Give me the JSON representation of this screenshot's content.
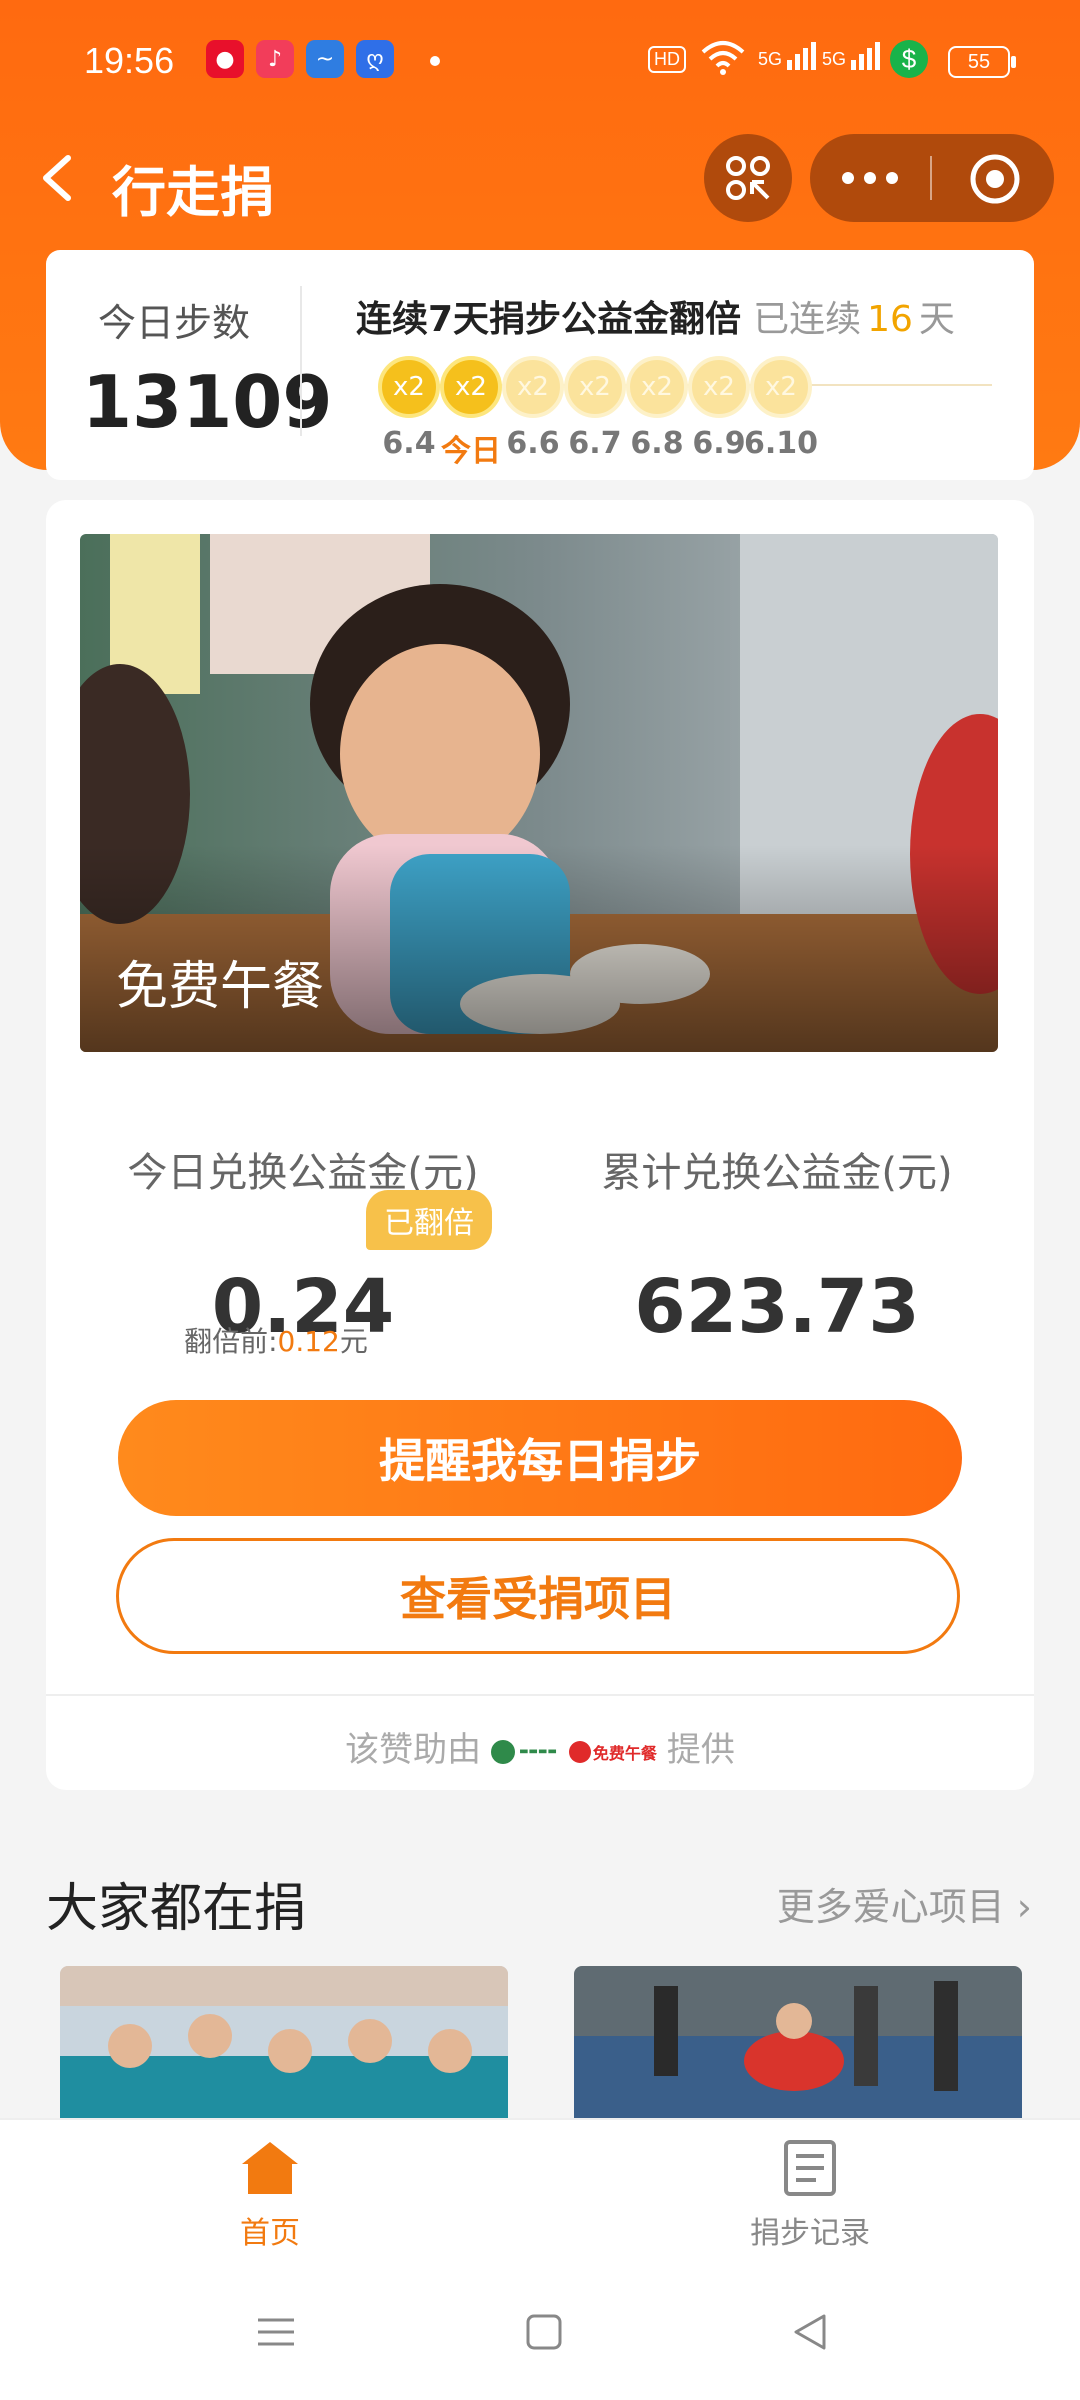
{
  "status_bar": {
    "time": "19:56",
    "apps": [
      {
        "icon": "taobao-icon",
        "color": "#e8102b"
      },
      {
        "icon": "music-icon",
        "color": "#f23d5a"
      },
      {
        "icon": "bird-icon",
        "color": "#2f7de1"
      },
      {
        "icon": "baidu-icon",
        "color": "#2f6fe8"
      }
    ],
    "network_hd": "HD",
    "signal_1": "5G",
    "signal_2": "5G",
    "battery": "55"
  },
  "nav": {
    "title": "行走捐"
  },
  "steps": {
    "label": "今日步数",
    "value": "13109",
    "streak_title": "连续7天捐步公益金翻倍",
    "streak_prefix": "已连续",
    "streak_days": "16",
    "streak_suffix": "天",
    "days": [
      {
        "label": "x2",
        "date": "6.4",
        "state": "done"
      },
      {
        "label": "x2",
        "date": "今日",
        "state": "today"
      },
      {
        "label": "x2",
        "date": "6.6",
        "state": "future"
      },
      {
        "label": "x2",
        "date": "6.7",
        "state": "future"
      },
      {
        "label": "x2",
        "date": "6.8",
        "state": "future"
      },
      {
        "label": "x2",
        "date": "6.9",
        "state": "future"
      },
      {
        "label": "x2",
        "date": "6.10",
        "state": "future"
      }
    ]
  },
  "project": {
    "caption": "免费午餐",
    "today_label": "今日兑换公益金(元)",
    "today_value": "0.24",
    "doubled_badge": "已翻倍",
    "before_label": "翻倍前:",
    "before_amount": "0.12",
    "before_unit": "元",
    "total_label": "累计兑换公益金(元)",
    "total_value": "623.73",
    "remind_button": "提醒我每日捐步",
    "view_button": "查看受捐项目",
    "sponsor_prefix": "该赞助由",
    "sponsor_suffix": "提供",
    "sponsor_logo_b_text": "免费午餐"
  },
  "section": {
    "title": "大家都在捐",
    "more": "更多爱心项目"
  },
  "tabbar": {
    "home": "首页",
    "records": "捐步记录"
  },
  "colors": {
    "brand_orange": "#ff6a10",
    "accent_orange": "#f27a10",
    "gold": "#f5c01c"
  }
}
